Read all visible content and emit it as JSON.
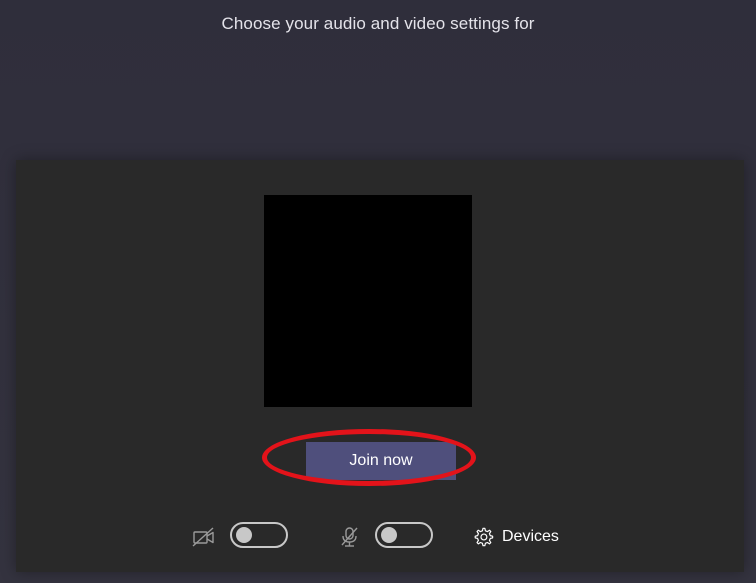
{
  "header": {
    "title": "Choose your audio and video settings for"
  },
  "preview": {
    "join_label": "Join now"
  },
  "controls": {
    "camera": {
      "icon": "camera-off-icon",
      "state": "off"
    },
    "microphone": {
      "icon": "mic-off-icon",
      "state": "off"
    },
    "devices": {
      "icon": "gear-icon",
      "label": "Devices"
    }
  },
  "colors": {
    "background": "#2f2e3b",
    "panel": "#292929",
    "join_button": "#4f4f7c",
    "highlight": "#e3131a"
  }
}
